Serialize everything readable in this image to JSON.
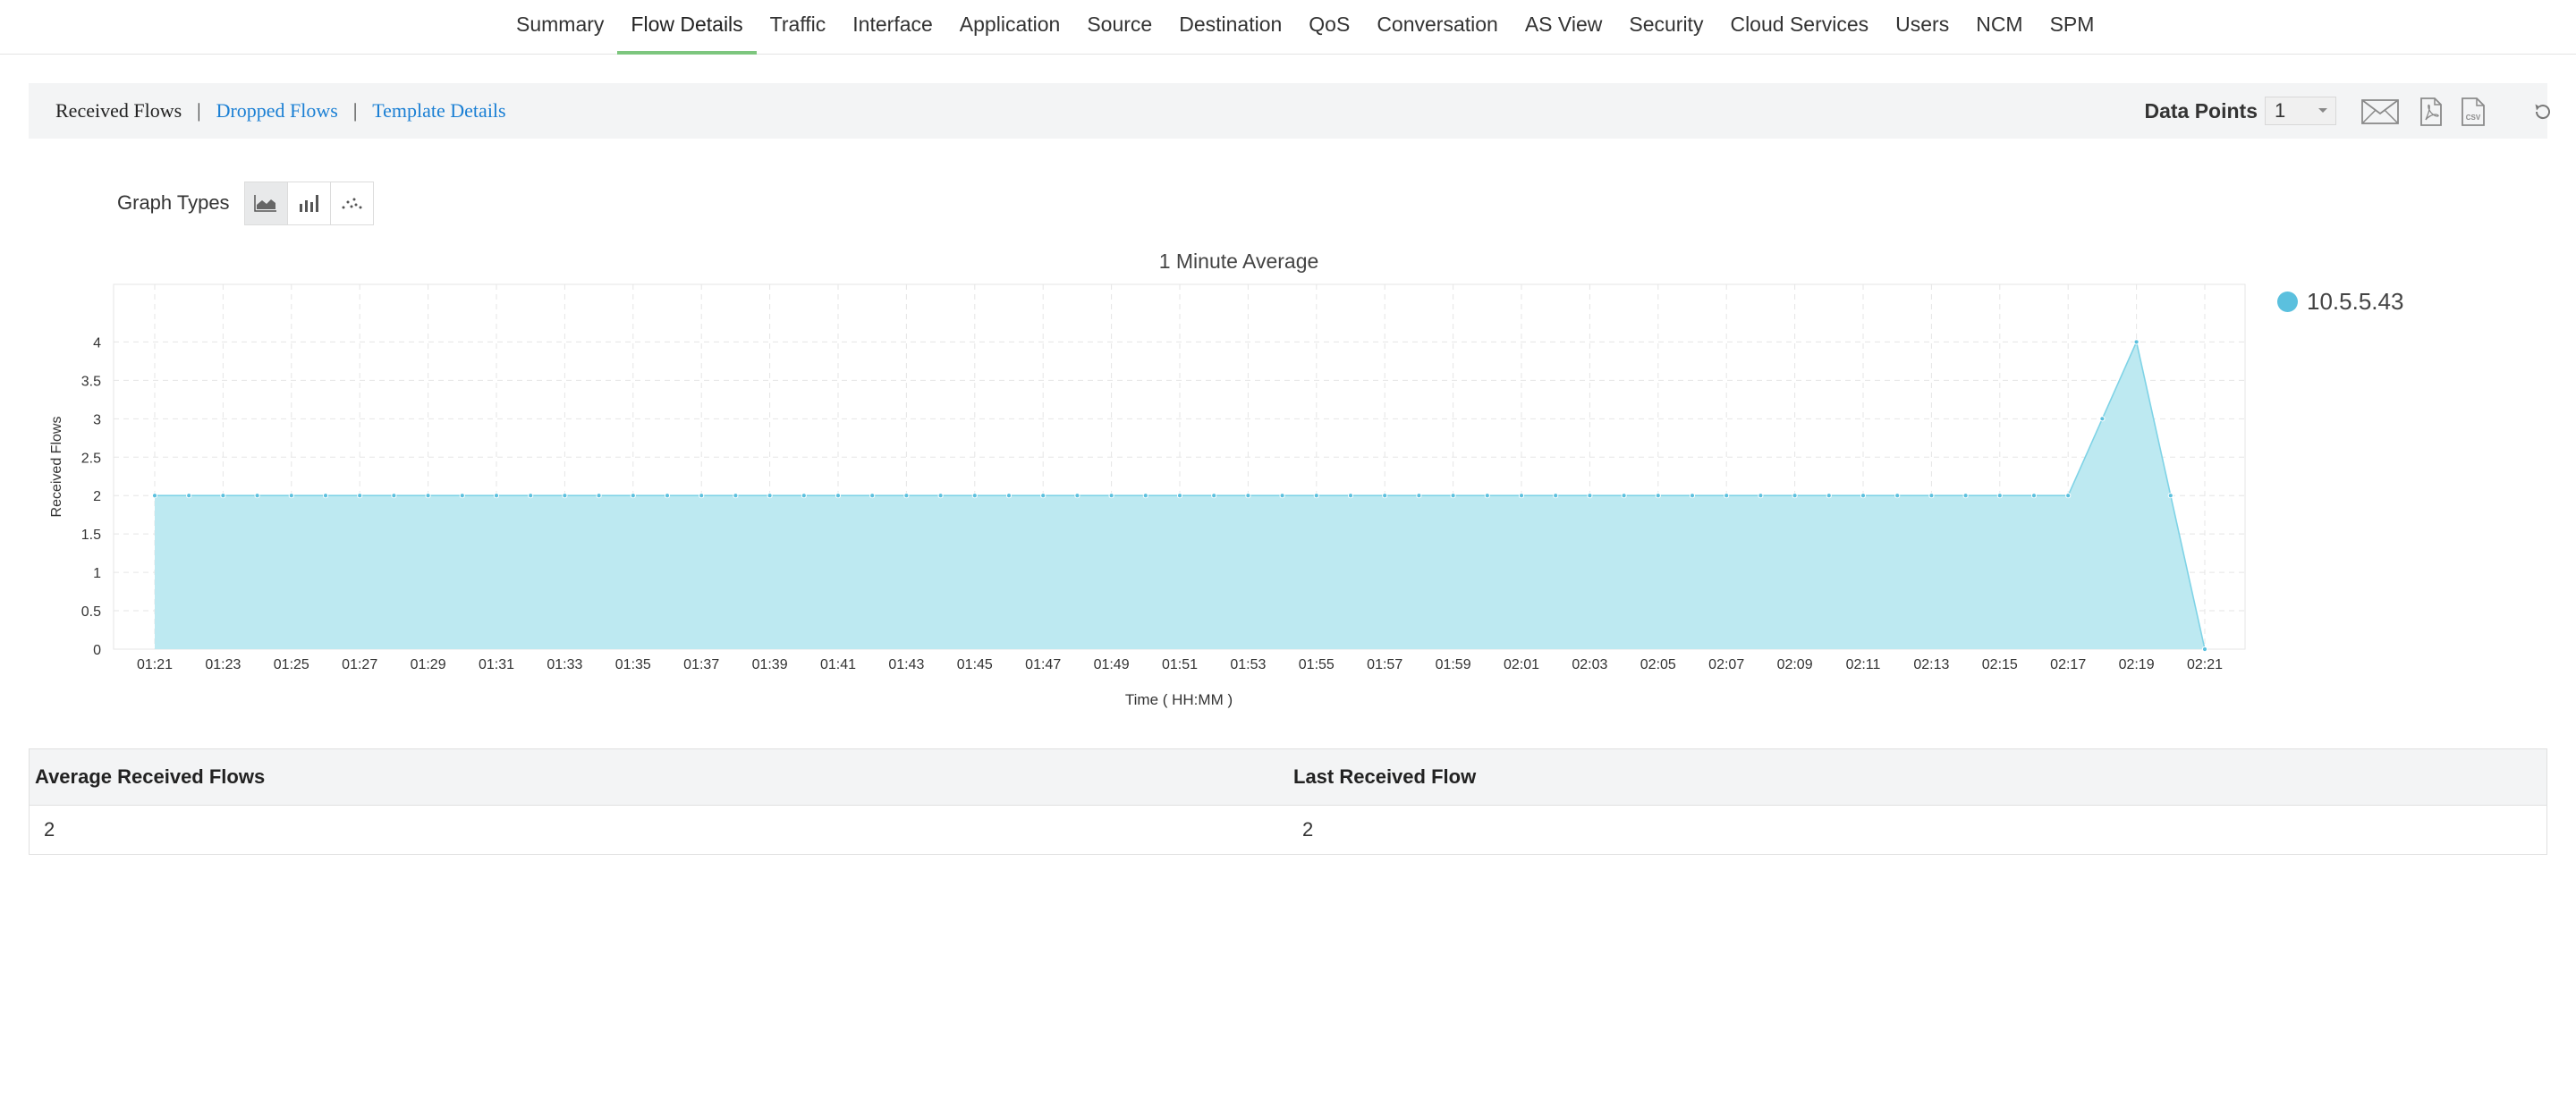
{
  "nav": {
    "tabs": [
      {
        "label": "Summary",
        "active": false
      },
      {
        "label": "Flow Details",
        "active": true
      },
      {
        "label": "Traffic",
        "active": false
      },
      {
        "label": "Interface",
        "active": false
      },
      {
        "label": "Application",
        "active": false
      },
      {
        "label": "Source",
        "active": false
      },
      {
        "label": "Destination",
        "active": false
      },
      {
        "label": "QoS",
        "active": false
      },
      {
        "label": "Conversation",
        "active": false
      },
      {
        "label": "AS View",
        "active": false
      },
      {
        "label": "Security",
        "active": false
      },
      {
        "label": "Cloud Services",
        "active": false
      },
      {
        "label": "Users",
        "active": false
      },
      {
        "label": "NCM",
        "active": false
      },
      {
        "label": "SPM",
        "active": false
      }
    ]
  },
  "subnav": {
    "received": "Received Flows",
    "dropped": "Dropped Flows",
    "template": "Template Details",
    "separator": "|"
  },
  "toolbar": {
    "data_points_label": "Data Points",
    "data_points_value": "1",
    "icons": [
      "mail-icon",
      "pdf-icon",
      "csv-icon",
      "refresh-icon"
    ]
  },
  "graph_types": {
    "label": "Graph Types",
    "options": [
      "area-chart-icon",
      "bar-chart-icon",
      "scatter-chart-icon"
    ],
    "selected": "area"
  },
  "legend": {
    "name": "10.5.5.43",
    "color": "#5bc0de"
  },
  "chart_data": {
    "type": "area",
    "title": "1 Minute Average",
    "xlabel": "Time ( HH:MM )",
    "ylabel": "Received Flows",
    "ylim": [
      0,
      4.75
    ],
    "yticks": [
      0,
      0.5,
      1,
      1.5,
      2,
      2.5,
      3,
      3.5,
      4
    ],
    "ytick_labels": [
      "0",
      "0.5",
      "1",
      "1.5",
      "2",
      "2.5",
      "3",
      "3.5",
      "4"
    ],
    "xtick_labels": [
      "01:21",
      "01:23",
      "01:25",
      "01:27",
      "01:29",
      "01:31",
      "01:33",
      "01:35",
      "01:37",
      "01:39",
      "01:41",
      "01:43",
      "01:45",
      "01:47",
      "01:49",
      "01:51",
      "01:53",
      "01:55",
      "01:57",
      "01:59",
      "02:01",
      "02:03",
      "02:05",
      "02:07",
      "02:09",
      "02:11",
      "02:13",
      "02:15",
      "02:17",
      "02:19",
      "02:21"
    ],
    "x": [
      "01:21",
      "01:22",
      "01:23",
      "01:24",
      "01:25",
      "01:26",
      "01:27",
      "01:28",
      "01:29",
      "01:30",
      "01:31",
      "01:32",
      "01:33",
      "01:34",
      "01:35",
      "01:36",
      "01:37",
      "01:38",
      "01:39",
      "01:40",
      "01:41",
      "01:42",
      "01:43",
      "01:44",
      "01:45",
      "01:46",
      "01:47",
      "01:48",
      "01:49",
      "01:50",
      "01:51",
      "01:52",
      "01:53",
      "01:54",
      "01:55",
      "01:56",
      "01:57",
      "01:58",
      "01:59",
      "02:00",
      "02:01",
      "02:02",
      "02:03",
      "02:04",
      "02:05",
      "02:06",
      "02:07",
      "02:08",
      "02:09",
      "02:10",
      "02:11",
      "02:12",
      "02:13",
      "02:14",
      "02:15",
      "02:16",
      "02:17",
      "02:18",
      "02:19",
      "02:20",
      "02:21"
    ],
    "series": [
      {
        "name": "10.5.5.43",
        "color": "#5bc0de",
        "values": [
          2,
          2,
          2,
          2,
          2,
          2,
          2,
          2,
          2,
          2,
          2,
          2,
          2,
          2,
          2,
          2,
          2,
          2,
          2,
          2,
          2,
          2,
          2,
          2,
          2,
          2,
          2,
          2,
          2,
          2,
          2,
          2,
          2,
          2,
          2,
          2,
          2,
          2,
          2,
          2,
          2,
          2,
          2,
          2,
          2,
          2,
          2,
          2,
          2,
          2,
          2,
          2,
          2,
          2,
          2,
          2,
          2,
          3,
          4,
          2,
          0
        ]
      }
    ],
    "grid": true,
    "legend_position": "right"
  },
  "summary": {
    "headers": [
      "Average Received Flows",
      "Last Received Flow"
    ],
    "values": [
      "2",
      "2"
    ]
  }
}
